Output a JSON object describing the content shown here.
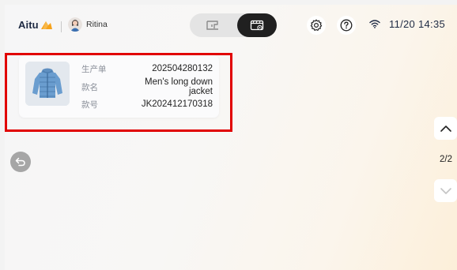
{
  "header": {
    "brand": "Aitu",
    "user_name": "Ritina",
    "datetime": "11/20 14:35",
    "modes": [
      {
        "name": "machine",
        "icon": "sewing-machine-icon",
        "selected": false
      },
      {
        "name": "media",
        "icon": "video-monitor-icon",
        "selected": true
      }
    ],
    "icons": [
      "settings-gear-icon",
      "help-icon",
      "wifi-icon"
    ]
  },
  "order_card": {
    "production_order_label": "生产单",
    "production_order_value": "202504280132",
    "style_name_label": "款名",
    "style_name_value": "Men's long down jacket",
    "style_no_label": "款号",
    "style_no_value": "JK202412170318",
    "thumbnail": "down-jacket-image"
  },
  "pagination": {
    "current": "2/2"
  },
  "colors": {
    "highlight": "#e10000",
    "brand_text": "#1e2a43",
    "brand_orange": "#f6a21a",
    "active_mode_bg": "#202020"
  }
}
